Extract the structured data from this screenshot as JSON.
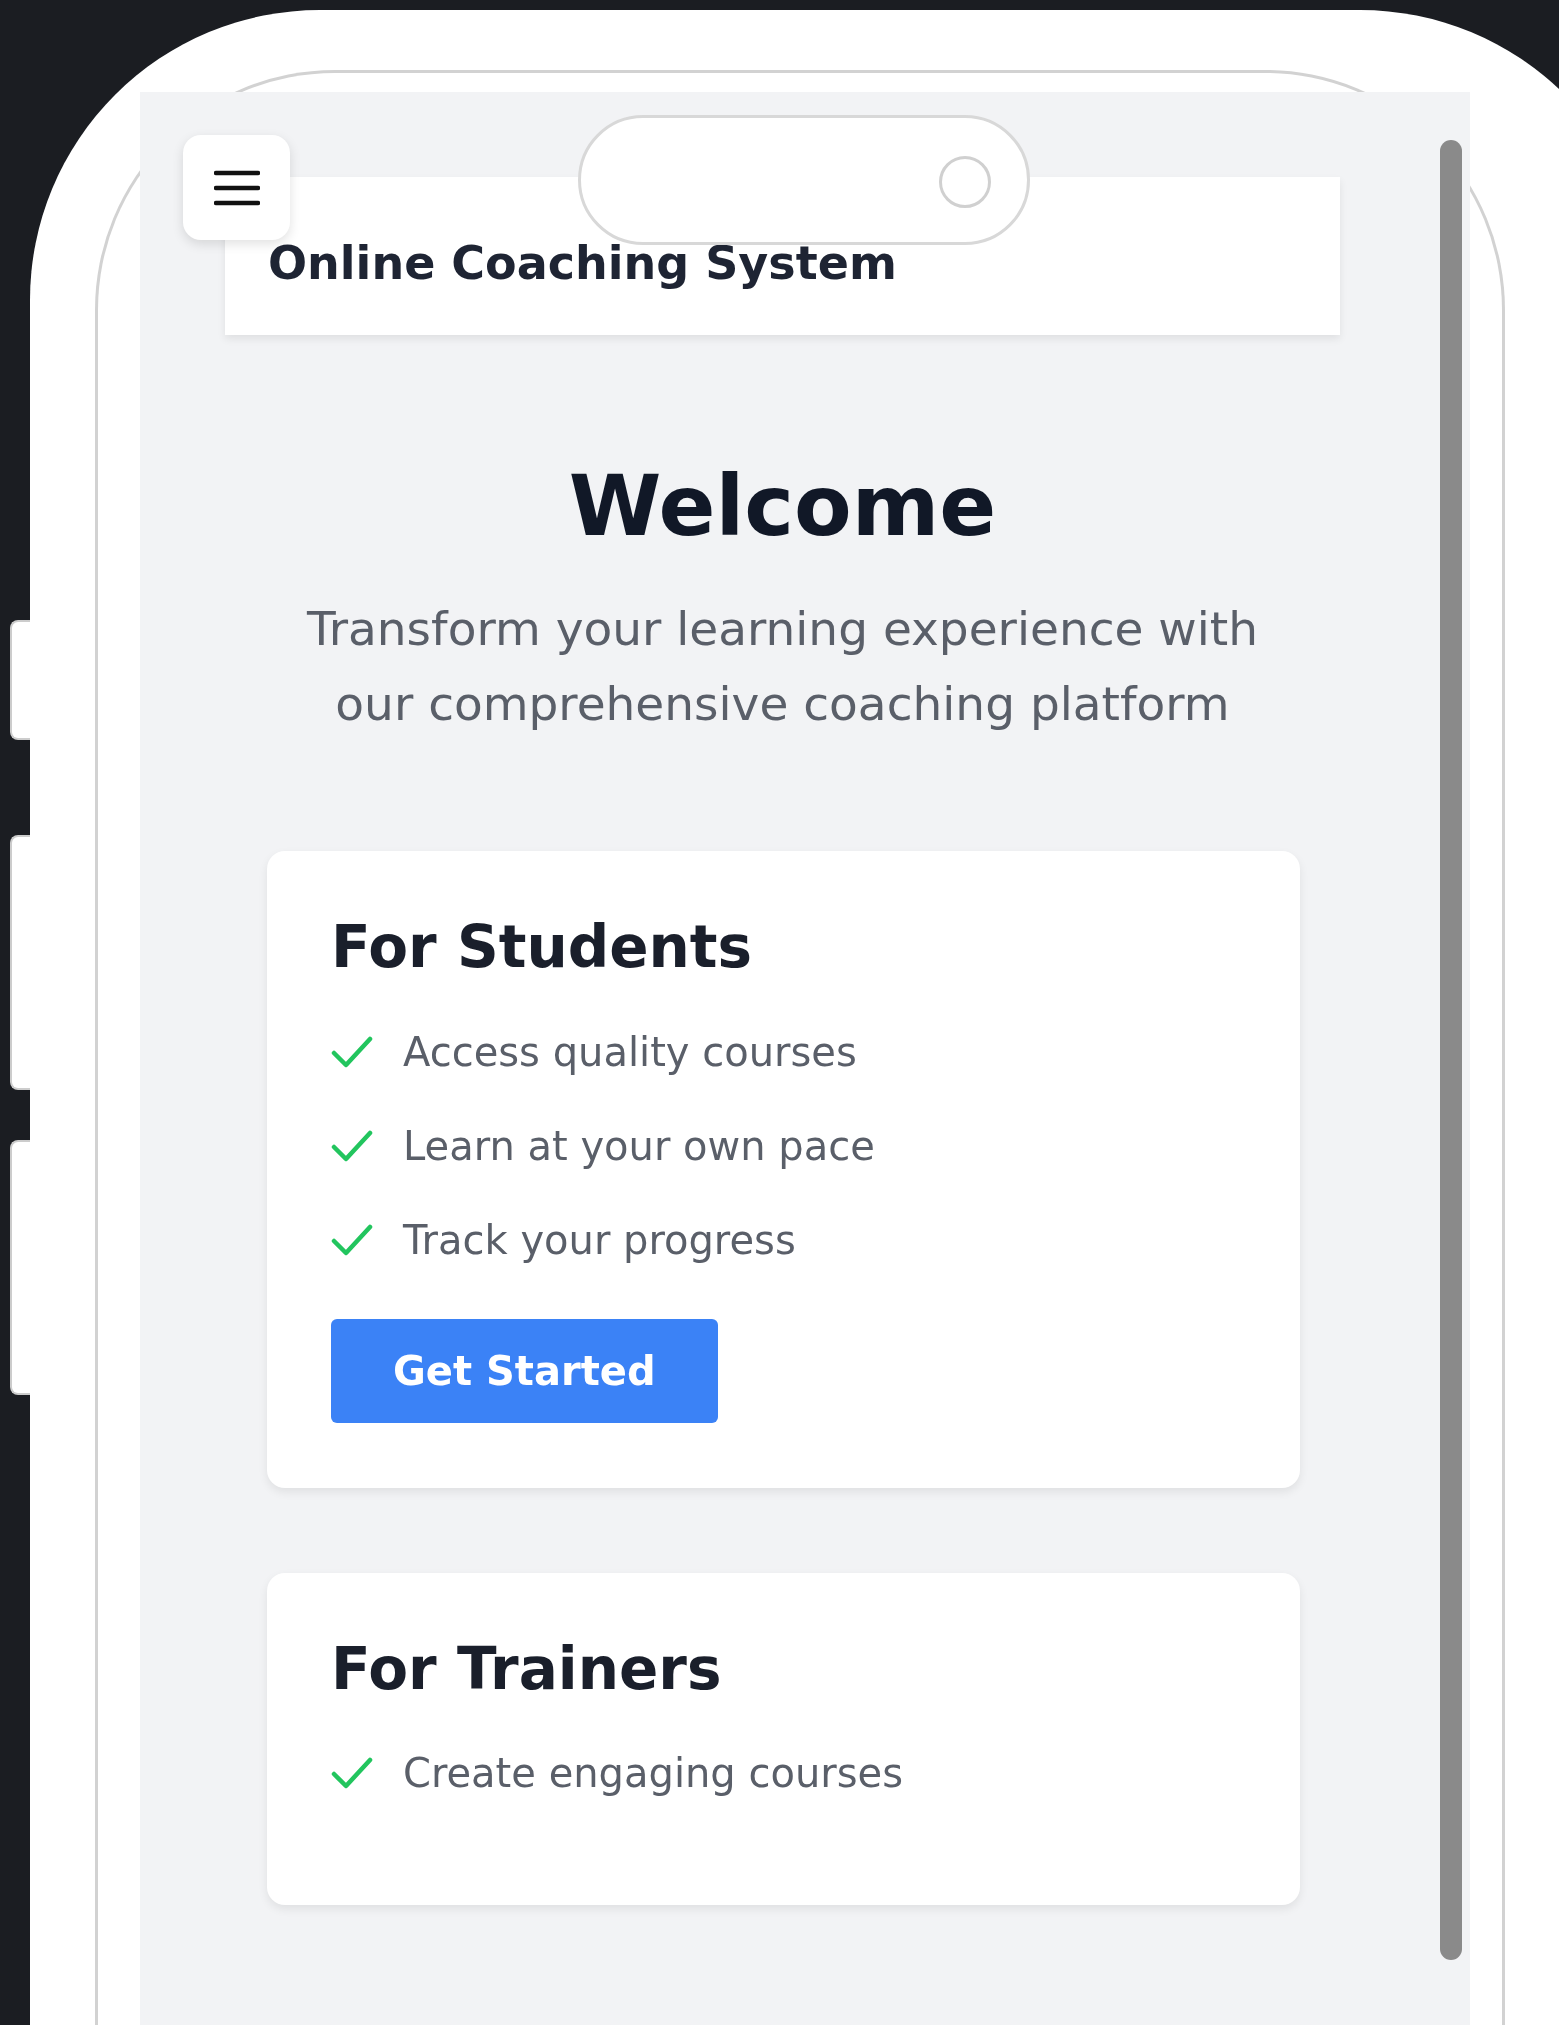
{
  "app_bar": {
    "title": "Online Coaching System"
  },
  "hero": {
    "title": "Welcome",
    "subtitle": "Transform your learning experience with our comprehensive coaching platform"
  },
  "cards": [
    {
      "title": "For Students",
      "features": [
        "Access quality courses",
        "Learn at your own pace",
        "Track your progress"
      ],
      "button": "Get Started"
    },
    {
      "title": "For Trainers",
      "features": [
        "Create engaging courses"
      ]
    }
  ]
}
